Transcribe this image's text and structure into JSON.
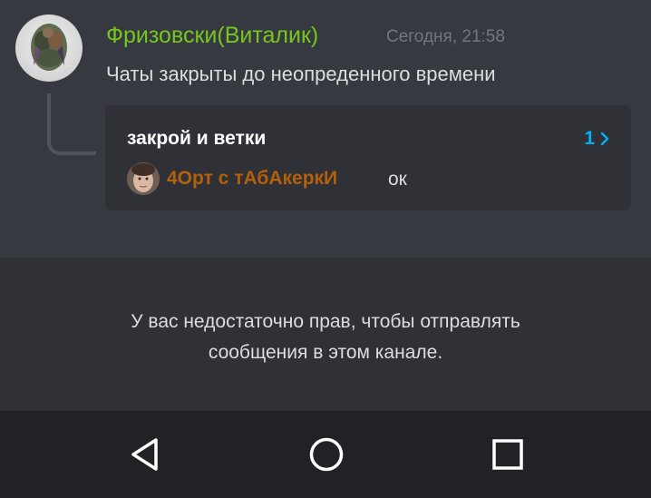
{
  "message": {
    "author": "Фризовски(Виталик)",
    "timestamp": "Сегодня, 21:58",
    "text": "Чаты закрыты до неопреденного времени",
    "author_color": "#77c61d"
  },
  "thread": {
    "title": "закрой и ветки",
    "count": "1",
    "last_reply_author": "4Орт с тАбАкеркИ",
    "last_reply_text": "ок",
    "reply_author_color": "#b3600a",
    "accent_color": "#00aff4"
  },
  "composer": {
    "permission_notice_line1": "У вас недостаточно прав, чтобы отправлять",
    "permission_notice_line2": "сообщения в этом канале."
  },
  "navbar": {
    "back_icon": "back-triangle-icon",
    "home_icon": "home-circle-icon",
    "recents_icon": "recents-square-icon"
  }
}
